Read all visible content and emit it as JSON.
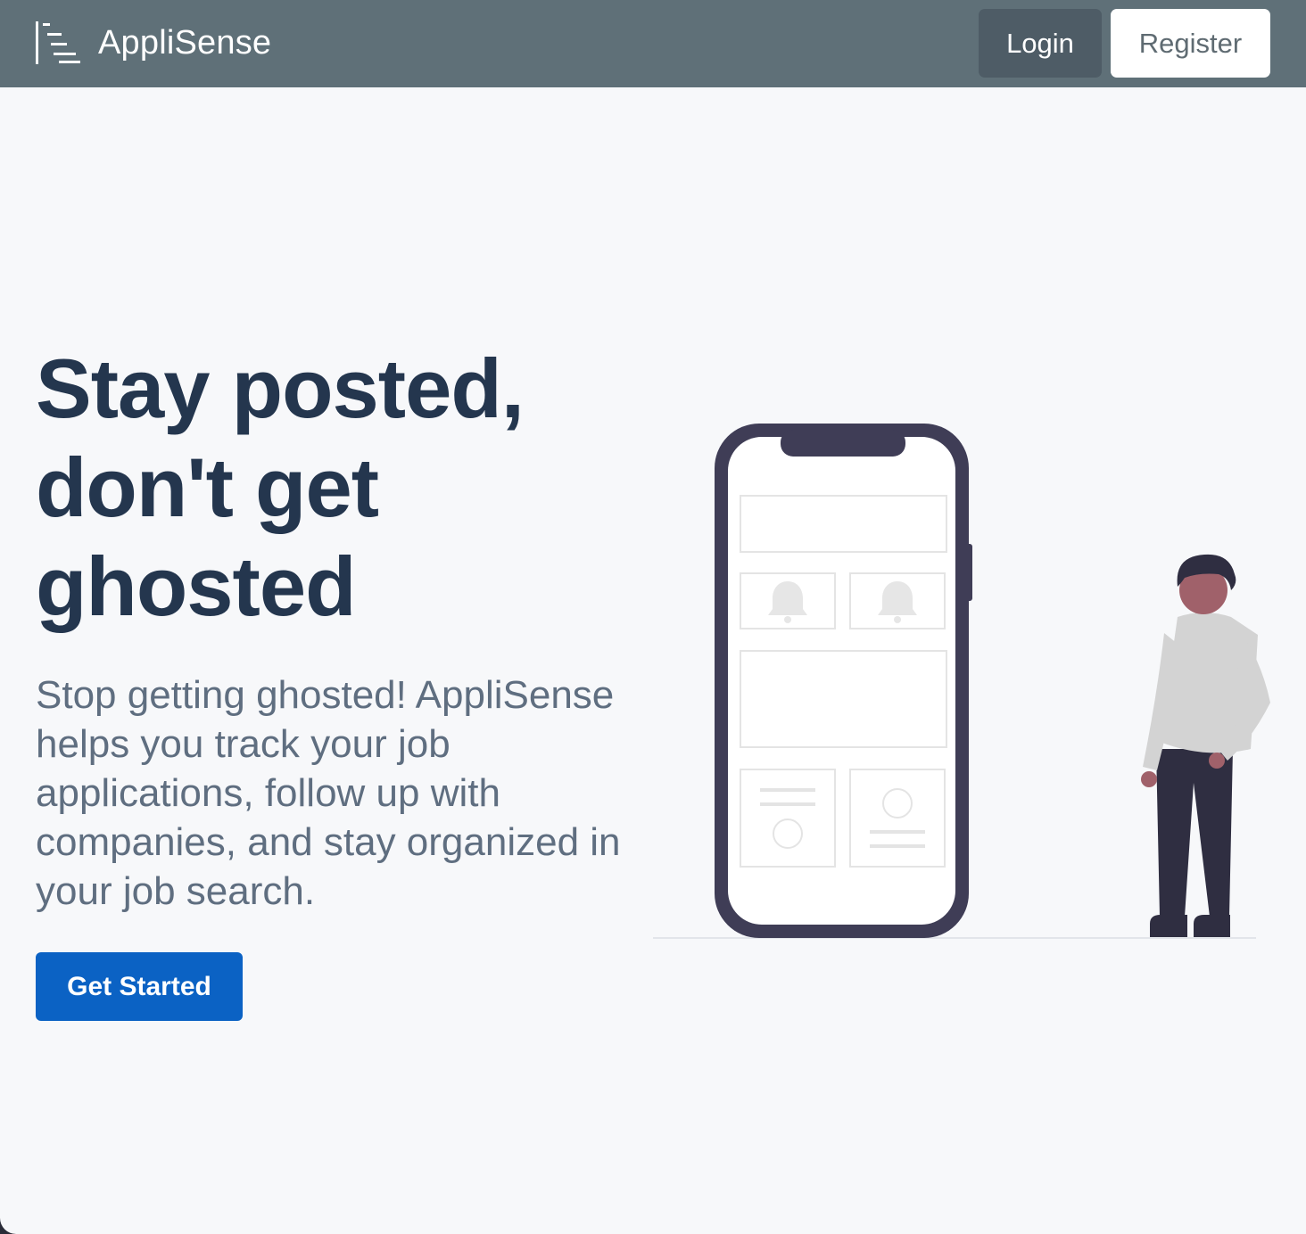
{
  "navbar": {
    "brand_name": "AppliSense",
    "brand_icon": "list-lines-icon",
    "login_label": "Login",
    "register_label": "Register"
  },
  "hero": {
    "title": "Stay posted, don't get ghosted",
    "description": "Stop getting ghosted! AppliSense helps you track your job applications, follow up with companies, and stay organized in your job search.",
    "cta_label": "Get Started"
  },
  "colors": {
    "navbar_bg": "#5f7078",
    "login_bg": "#4e5c66",
    "heading": "#24364e",
    "body_text": "#5f6e80",
    "cta_bg": "#0b62c4",
    "page_bg": "#f7f8fa"
  }
}
